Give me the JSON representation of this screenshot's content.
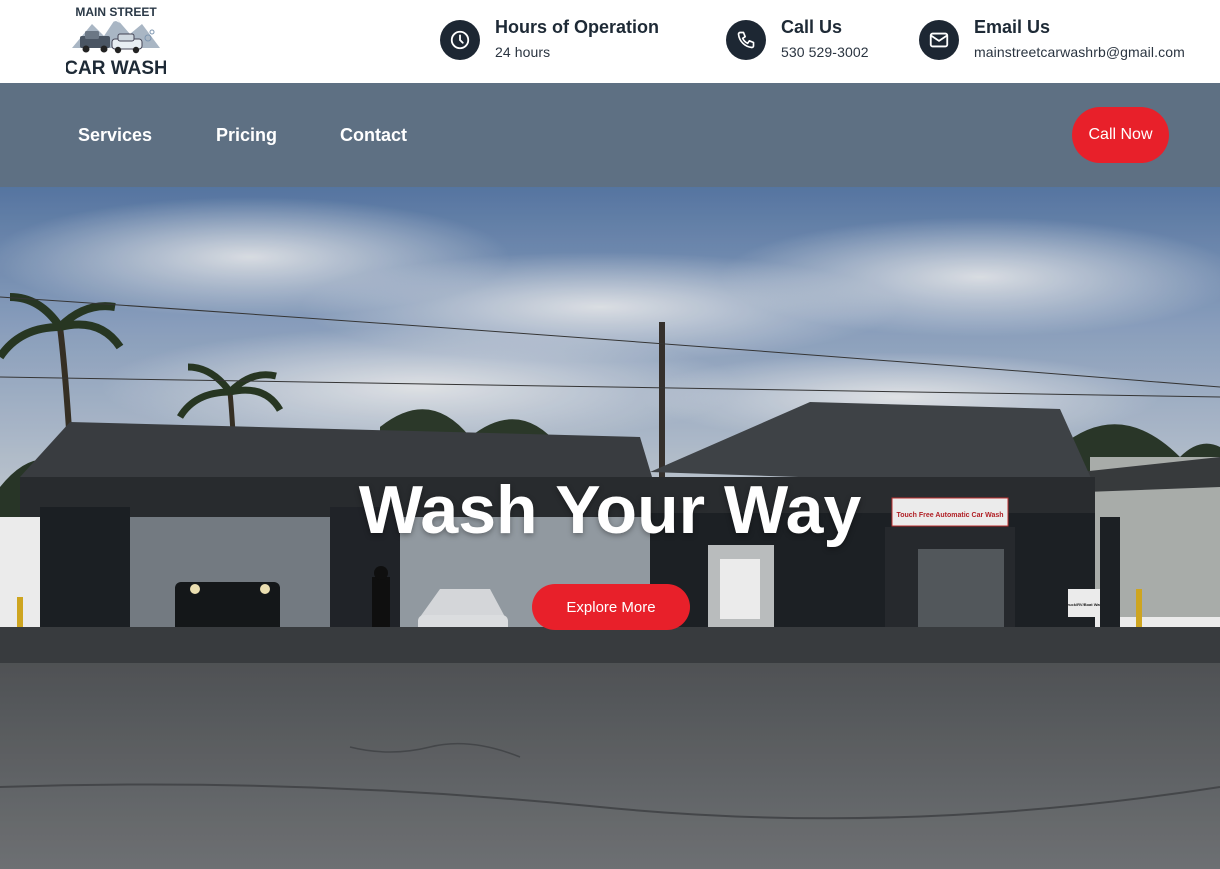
{
  "logo": {
    "top_text": "MAIN STREET",
    "bottom_text": "CAR WASH",
    "icon": "car-wash-logo"
  },
  "header": {
    "hours": {
      "title": "Hours of Operation",
      "value": "24 hours",
      "icon": "clock-icon"
    },
    "call": {
      "title": "Call Us",
      "value": "530 529-3002",
      "icon": "phone-icon"
    },
    "email": {
      "title": "Email Us",
      "value": "mainstreetcarwashrb@gmail.com",
      "icon": "mail-icon"
    }
  },
  "nav": {
    "items": [
      {
        "label": "Services"
      },
      {
        "label": "Pricing"
      },
      {
        "label": "Contact"
      }
    ],
    "cta_label": "Call Now"
  },
  "hero": {
    "title": "Wash Your Way",
    "button_label": "Explore More",
    "signs": {
      "touch_free": "Touch Free Automatic Car Wash",
      "truck_bay": "Truck/RV/Boat Wash Bay"
    }
  },
  "colors": {
    "accent": "#e8202a",
    "nav_bg": "#5e7083",
    "icon_circle": "#1d2733",
    "text_dark": "#1e2a36"
  }
}
